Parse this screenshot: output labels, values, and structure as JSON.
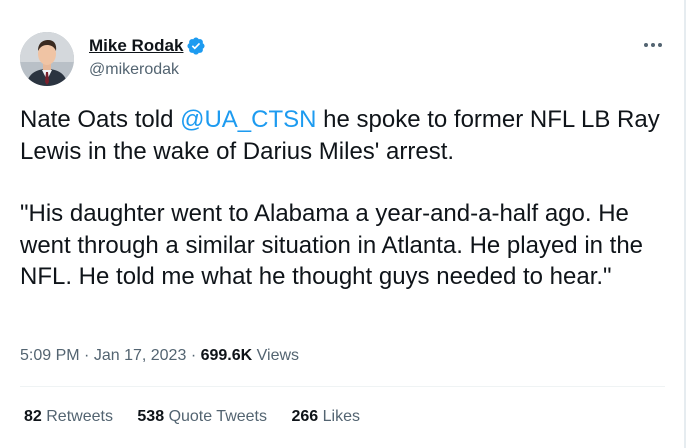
{
  "author": {
    "display_name": "Mike Rodak",
    "handle": "@mikerodak",
    "verified_icon": "verified-badge-icon",
    "avatar_icon": "profile-avatar"
  },
  "tweet": {
    "line1_before": "Nate Oats told ",
    "mention": "@UA_CTSN",
    "line1_after": " he spoke to former NFL LB Ray Lewis in the wake of Darius Miles' arrest.",
    "quote": "\"His daughter went to Alabama a year-and-a-half ago. He went through a similar situation in Atlanta. He played in the NFL. He told me what he thought guys needed to hear.\""
  },
  "meta": {
    "time": "5:09 PM",
    "separator": "·",
    "date": "Jan 17, 2023",
    "views_count": "699.6K",
    "views_label": "Views"
  },
  "stats": {
    "retweets_count": "82",
    "retweets_label": "Retweets",
    "quotes_count": "538",
    "quotes_label": "Quote Tweets",
    "likes_count": "266",
    "likes_label": "Likes"
  },
  "colors": {
    "accent": "#1d9bf0",
    "text_primary": "#0f1419",
    "text_secondary": "#536471"
  },
  "more_icon": "more-horizontal-icon"
}
